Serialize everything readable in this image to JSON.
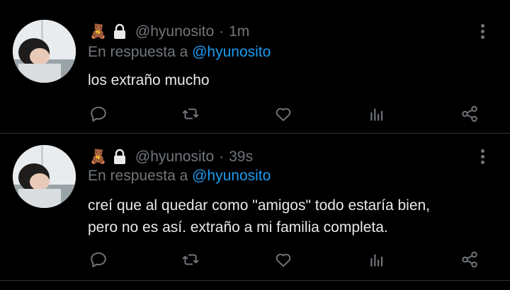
{
  "colors": {
    "background": "#000000",
    "text": "#e7e9ea",
    "muted": "#71767b",
    "link": "#1d9bf0",
    "divider": "#2f3336"
  },
  "tweets": [
    {
      "emoji": "🧸",
      "handle": "@hyunosito",
      "separator": "·",
      "time": "1m",
      "reply_prefix": "En respuesta a",
      "reply_mention": "@hyunosito",
      "text_lines": [
        "los extraño mucho"
      ],
      "icons": [
        "teddy-bear-icon",
        "lock-icon",
        "more-options-icon",
        "reply-icon",
        "retweet-icon",
        "like-icon",
        "analytics-icon",
        "share-icon"
      ]
    },
    {
      "emoji": "🧸",
      "handle": "@hyunosito",
      "separator": "·",
      "time": "39s",
      "reply_prefix": "En respuesta a",
      "reply_mention": "@hyunosito",
      "text_lines": [
        "creí que al quedar como \"amigos\" todo estaría bien,",
        "pero no es así. extraño a mi familia completa."
      ],
      "icons": [
        "teddy-bear-icon",
        "lock-icon",
        "more-options-icon",
        "reply-icon",
        "retweet-icon",
        "like-icon",
        "analytics-icon",
        "share-icon"
      ]
    }
  ]
}
